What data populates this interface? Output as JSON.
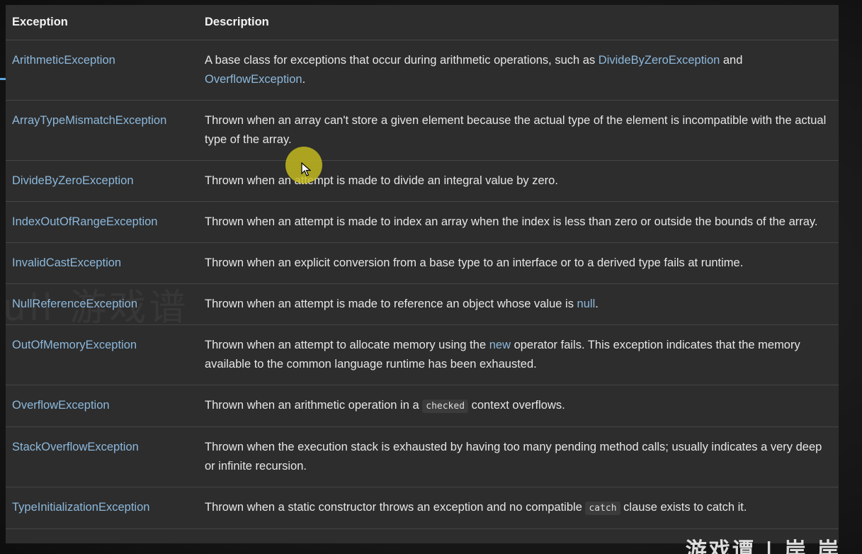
{
  "table": {
    "headers": {
      "exception": "Exception",
      "description": "Description"
    },
    "rows": [
      {
        "name": "ArithmeticException",
        "parts": [
          {
            "text": "A base class for exceptions that occur during arithmetic operations, such as "
          },
          {
            "text": "DivideByZeroException",
            "type": "link"
          },
          {
            "text": " and "
          },
          {
            "text": "OverflowException",
            "type": "link"
          },
          {
            "text": "."
          }
        ]
      },
      {
        "name": "ArrayTypeMismatchException",
        "parts": [
          {
            "text": "Thrown when an array can't store a given element because the actual type of the element is incompatible with the actual type of the array."
          }
        ]
      },
      {
        "name": "DivideByZeroException",
        "parts": [
          {
            "text": "Thrown when an attempt is made to divide an integral value by zero."
          }
        ]
      },
      {
        "name": "IndexOutOfRangeException",
        "parts": [
          {
            "text": "Thrown when an attempt is made to index an array when the index is less than zero or outside the bounds of the array."
          }
        ]
      },
      {
        "name": "InvalidCastException",
        "parts": [
          {
            "text": "Thrown when an explicit conversion from a base type to an interface or to a derived type fails at runtime."
          }
        ]
      },
      {
        "name": "NullReferenceException",
        "parts": [
          {
            "text": "Thrown when an attempt is made to reference an object whose value is "
          },
          {
            "text": "null",
            "type": "link"
          },
          {
            "text": "."
          }
        ]
      },
      {
        "name": "OutOfMemoryException",
        "parts": [
          {
            "text": "Thrown when an attempt to allocate memory using the "
          },
          {
            "text": "new",
            "type": "link"
          },
          {
            "text": " operator fails. This exception indicates that the memory available to the common language runtime has been exhausted."
          }
        ]
      },
      {
        "name": "OverflowException",
        "parts": [
          {
            "text": "Thrown when an arithmetic operation in a "
          },
          {
            "text": "checked",
            "type": "code"
          },
          {
            "text": " context overflows."
          }
        ]
      },
      {
        "name": "StackOverflowException",
        "parts": [
          {
            "text": "Thrown when the execution stack is exhausted by having too many pending method calls; usually indicates a very deep or infinite recursion."
          }
        ]
      },
      {
        "name": "TypeInitializationException",
        "parts": [
          {
            "text": "Thrown when a static constructor throws an exception and no compatible "
          },
          {
            "text": "catch",
            "type": "code"
          },
          {
            "text": " clause exists to catch it."
          }
        ]
      }
    ]
  },
  "overlay": {
    "watermark": "ull 游戏谱",
    "corner_logo": "游戏谭 | 岸 岸",
    "cursor_icon": "pointer-arrow-icon",
    "highlight_color": "#c8be1e",
    "link_color": "#8cb8dc"
  }
}
